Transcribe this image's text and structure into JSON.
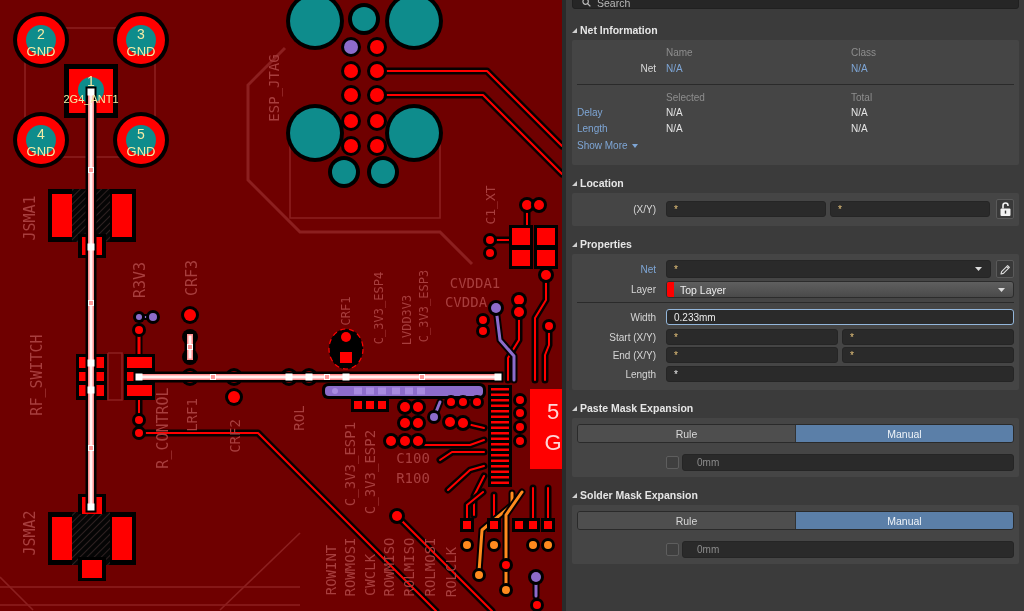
{
  "pcb": {
    "pad_labels": [
      {
        "number": "2",
        "net": "GND"
      },
      {
        "number": "3",
        "net": "GND"
      },
      {
        "number": "1",
        "net": "2G4_ANT1"
      },
      {
        "number": "4",
        "net": "GND"
      },
      {
        "number": "5",
        "net": "GND"
      }
    ],
    "designators": [
      "JSMA1",
      "ESP_JTAG",
      "R3V3",
      "CRF3",
      "CRF1",
      "C_3V3_ESP4",
      "LVDD3V3",
      "C_3V3_ESP3",
      "C1_XT",
      "CVDDA1",
      "CVDDA",
      "RF_SWITCH",
      "R_CONTROL",
      "LRF1",
      "CRF2",
      "ROL",
      "C_3V3_ESP1",
      "C_3V3_ESP2",
      "C100",
      "R100",
      "JSMA2",
      "ROWINT",
      "ROWMOSI",
      "CWCLK",
      "ROWMISO",
      "ROLMISO",
      "ROLMOSI",
      "ROLCLK"
    ],
    "component_label": [
      "5",
      "G"
    ]
  },
  "panel": {
    "search": {
      "placeholder": "Search"
    },
    "net_information": {
      "title": "Net Information",
      "expanded": true,
      "net_columns": [
        "Name",
        "Class"
      ],
      "net_rows": [
        {
          "label": "Net",
          "values": [
            "N/A",
            "N/A"
          ]
        }
      ],
      "stat_columns": [
        "Selected",
        "Total"
      ],
      "stat_rows": [
        {
          "label": "Delay",
          "values": [
            "N/A",
            "N/A"
          ]
        },
        {
          "label": "Length",
          "values": [
            "N/A",
            "N/A"
          ]
        }
      ],
      "show_more": "Show More"
    },
    "location": {
      "title": "Location",
      "expanded": true,
      "label": "(X/Y)",
      "values": [
        "*",
        "*"
      ],
      "locked": false
    },
    "properties": {
      "title": "Properties",
      "expanded": true,
      "selects": [
        {
          "kind": "net",
          "label": "Net",
          "value": "*",
          "link": true
        },
        {
          "kind": "layer",
          "label": "Layer",
          "value": "Top Layer",
          "color": "#ff0000",
          "link": false
        }
      ],
      "fields": [
        {
          "kind": "single",
          "label": "Width",
          "values": [
            "0.233mm"
          ],
          "focused": true
        },
        {
          "kind": "pair",
          "label": "Start (X/Y)",
          "values": [
            "*",
            "*"
          ],
          "focused": false
        },
        {
          "kind": "pair",
          "label": "End (X/Y)",
          "values": [
            "*",
            "*"
          ],
          "focused": false
        },
        {
          "kind": "single",
          "label": "Length",
          "values": [
            "*"
          ],
          "focused": false
        }
      ]
    },
    "paste_mask": {
      "title": "Paste Mask Expansion",
      "expanded": true,
      "modes": [
        {
          "label": "Rule",
          "selected": false
        },
        {
          "label": "Manual",
          "selected": true
        }
      ],
      "checked": false,
      "value": "0mm"
    },
    "solder_mask": {
      "title": "Solder Mask Expansion",
      "expanded": true,
      "modes": [
        {
          "label": "Rule",
          "selected": false
        },
        {
          "label": "Manual",
          "selected": true
        }
      ],
      "checked": false,
      "value": "0mm"
    }
  }
}
